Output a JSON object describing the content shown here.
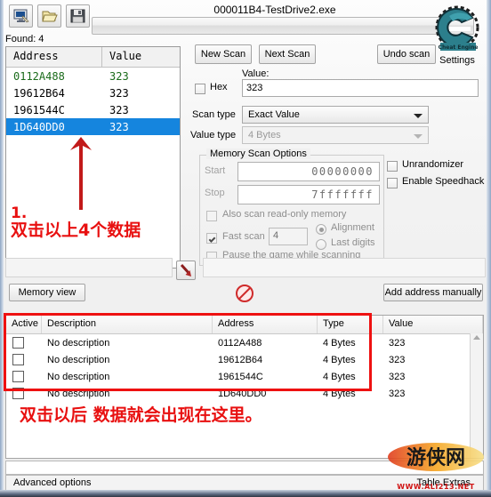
{
  "window": {
    "title": "000011B4-TestDrive2.exe",
    "found_label": "Found: 4",
    "progress_value": 0
  },
  "toolbar": {
    "items": [
      {
        "name": "open-process-icon",
        "label": "Open Process"
      },
      {
        "name": "open-file-icon",
        "label": "Open"
      },
      {
        "name": "save-icon",
        "label": "Save"
      }
    ]
  },
  "logo": {
    "brand": "Cheat Engine",
    "settings_label": "Settings"
  },
  "results": {
    "columns": [
      "Address",
      "Value"
    ],
    "rows": [
      {
        "address": "0112A488",
        "value": "323",
        "style": "green",
        "selected": false
      },
      {
        "address": "19612B64",
        "value": "323",
        "style": "normal",
        "selected": false
      },
      {
        "address": "1961544C",
        "value": "323",
        "style": "normal",
        "selected": false
      },
      {
        "address": "1D640DD0",
        "value": "323",
        "style": "normal",
        "selected": true
      }
    ]
  },
  "annotations": {
    "step_number": "1.",
    "note_top": "双击以上4个数据",
    "note_bottom": "双击以后 数据就会出现在这里。",
    "accent_color": "#e81010"
  },
  "scan": {
    "new_scan_label": "New Scan",
    "next_scan_label": "Next Scan",
    "undo_scan_label": "Undo scan",
    "value_label": "Value:",
    "value_input": "323",
    "hex_label": "Hex",
    "hex_checked": false,
    "scan_type_label": "Scan type",
    "scan_type_value": "Exact Value",
    "value_type_label": "Value type",
    "value_type_value": "4 Bytes",
    "memory_options": {
      "title": "Memory Scan Options",
      "start_label": "Start",
      "start_value": "00000000",
      "stop_label": "Stop",
      "stop_value": "7fffffff",
      "readonly_label": "Also scan read-only memory",
      "readonly_checked": false,
      "fast_scan_label": "Fast scan",
      "fast_scan_checked": true,
      "fast_scan_value": "4",
      "alignment_label": "Alignment",
      "alignment_selected": true,
      "last_digits_label": "Last digits",
      "last_digits_selected": false,
      "pause_label": "Pause the game while scanning",
      "pause_checked": false
    },
    "unrandomizer_label": "Unrandomizer",
    "unrandomizer_checked": false,
    "speedhack_label": "Enable Speedhack",
    "speedhack_checked": false
  },
  "midbar": {
    "memory_view_label": "Memory view",
    "add_address_label": "Add address manually"
  },
  "cheat_table": {
    "columns": [
      "Active",
      "Description",
      "Address",
      "Type",
      "Value"
    ],
    "rows": [
      {
        "active": false,
        "description": "No description",
        "address": "0112A488",
        "type": "4 Bytes",
        "value": "323"
      },
      {
        "active": false,
        "description": "No description",
        "address": "19612B64",
        "type": "4 Bytes",
        "value": "323"
      },
      {
        "active": false,
        "description": "No description",
        "address": "1961544C",
        "type": "4 Bytes",
        "value": "323"
      },
      {
        "active": false,
        "description": "No description",
        "address": "1D640DD0",
        "type": "4 Bytes",
        "value": "323"
      }
    ]
  },
  "statusbar": {
    "advanced_options": "Advanced options",
    "table_extras": "Table Extras"
  },
  "watermark": {
    "url": "WWW.ALI213.NET",
    "brand": "游侠网"
  }
}
